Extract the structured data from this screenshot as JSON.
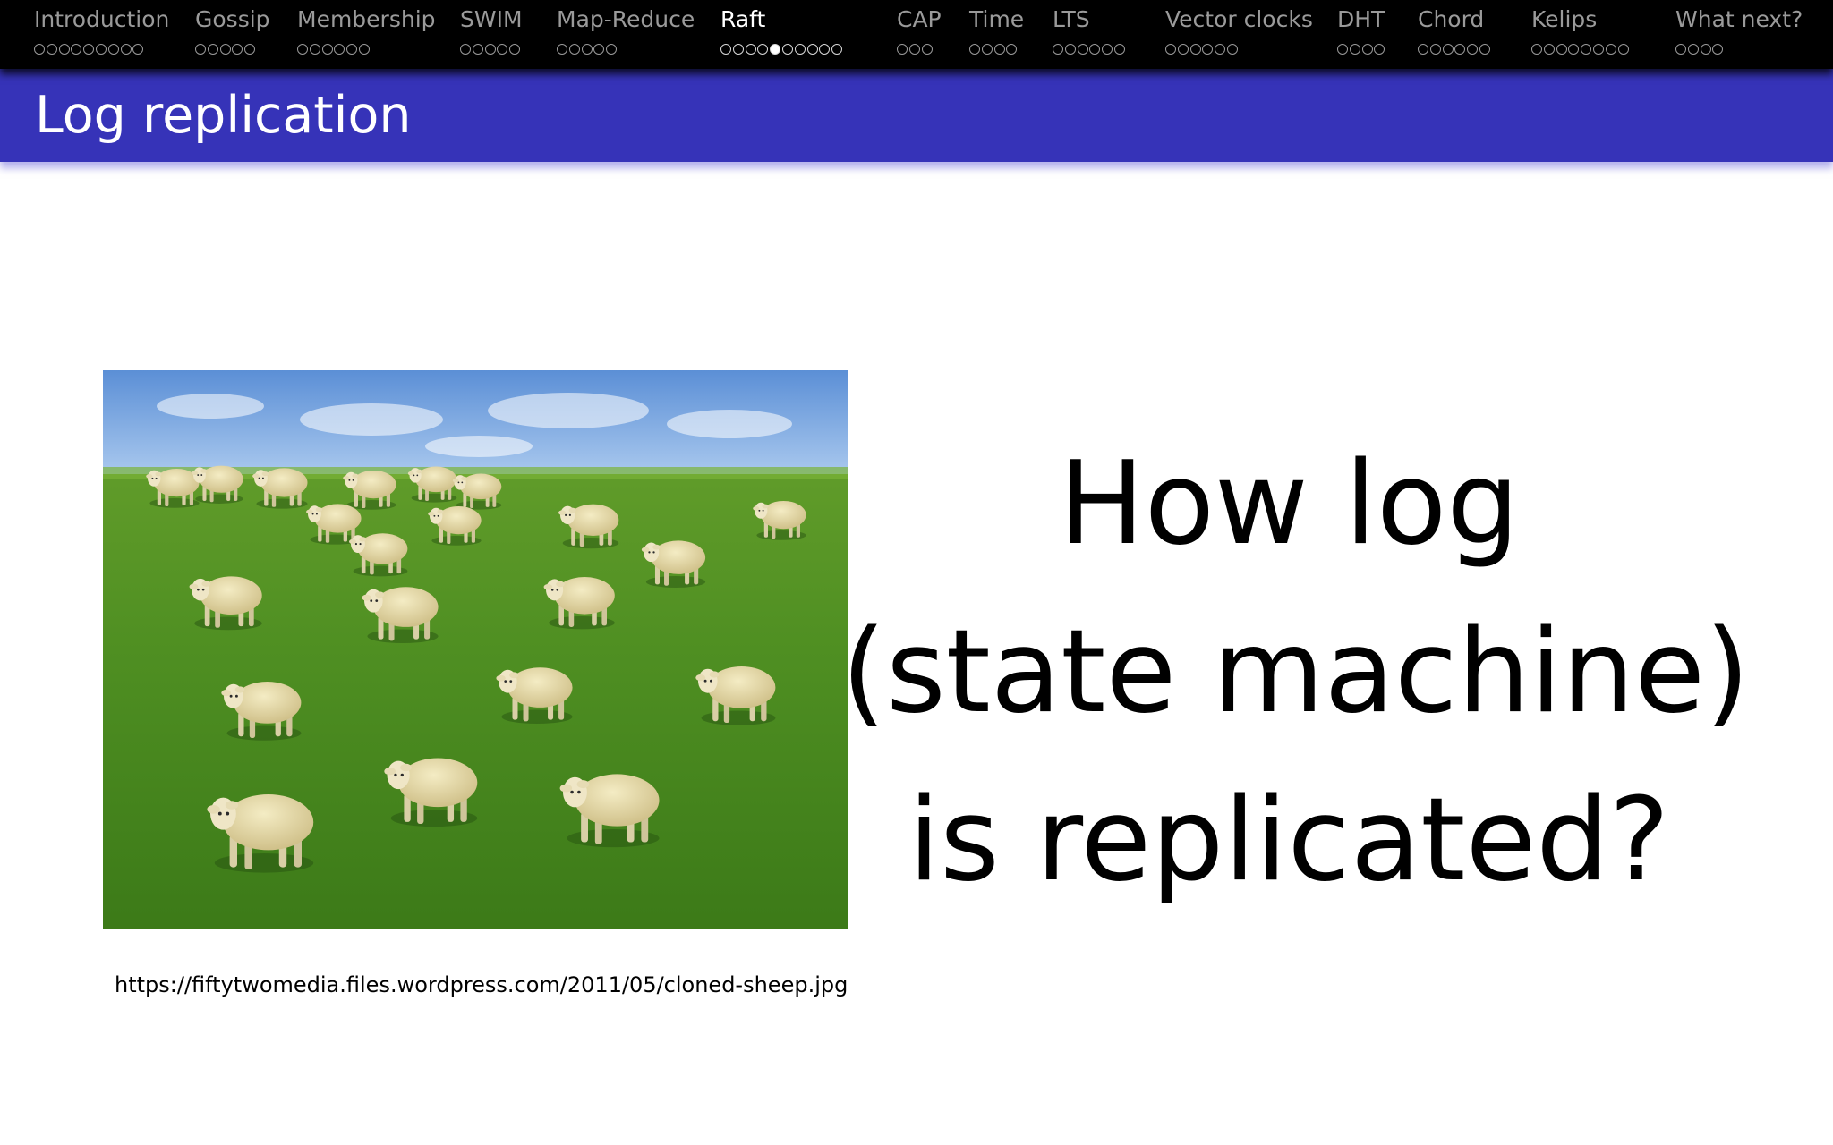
{
  "navigation": {
    "sections": [
      {
        "title": "Introduction",
        "slides": 9,
        "current": null
      },
      {
        "title": "Gossip",
        "slides": 5,
        "current": null
      },
      {
        "title": "Membership",
        "slides": 6,
        "current": null
      },
      {
        "title": "SWIM",
        "slides": 5,
        "current": null
      },
      {
        "title": "Map-Reduce",
        "slides": 5,
        "current": null
      },
      {
        "title": "Raft",
        "slides": 10,
        "current": 4,
        "active": true
      },
      {
        "title": "CAP",
        "slides": 3,
        "current": null
      },
      {
        "title": "Time",
        "slides": 4,
        "current": null
      },
      {
        "title": "LTS",
        "slides": 6,
        "current": null
      },
      {
        "title": "Vector clocks",
        "slides": 6,
        "current": null
      },
      {
        "title": "DHT",
        "slides": 4,
        "current": null
      },
      {
        "title": "Chord",
        "slides": 6,
        "current": null
      },
      {
        "title": "Kelips",
        "slides": 8,
        "current": null
      },
      {
        "title": "What next?",
        "slides": 4,
        "current": null
      }
    ]
  },
  "slide": {
    "title": "Log replication",
    "question_lines": [
      "How log",
      "(state machine)",
      "is replicated?"
    ],
    "image_caption": "https://fiftytwomedia.files.wordpress.com/2011/05/cloned-sheep.jpg"
  },
  "colors": {
    "nav_background": "#000000",
    "title_bar": "#3633b8",
    "nav_inactive": "#9a9a9a",
    "nav_active": "#ffffff"
  }
}
